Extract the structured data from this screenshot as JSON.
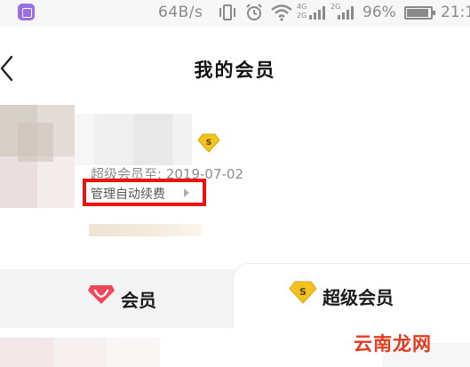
{
  "status_bar": {
    "net_speed": "64B/s",
    "net_4g": "4G",
    "net_2g_top": "2G",
    "net_2g_bottom": "2G",
    "battery": "96%",
    "clock": "21:1"
  },
  "header": {
    "title": "我的会员"
  },
  "profile": {
    "expire_label": "超级会员至: 2019-07-02",
    "manage_renew": "管理自动续费"
  },
  "tabs": [
    {
      "label": "会员"
    },
    {
      "label": "超级会员"
    }
  ],
  "icons": {
    "back": "chevron-left-icon",
    "vip": "diamond-s-icon",
    "member": "heart-diamond-icon"
  },
  "colors": {
    "highlight_box": "#ee1111",
    "diamond_gold": "#f2c31e",
    "member_red": "#f0465a"
  },
  "watermark": "云南龙网"
}
